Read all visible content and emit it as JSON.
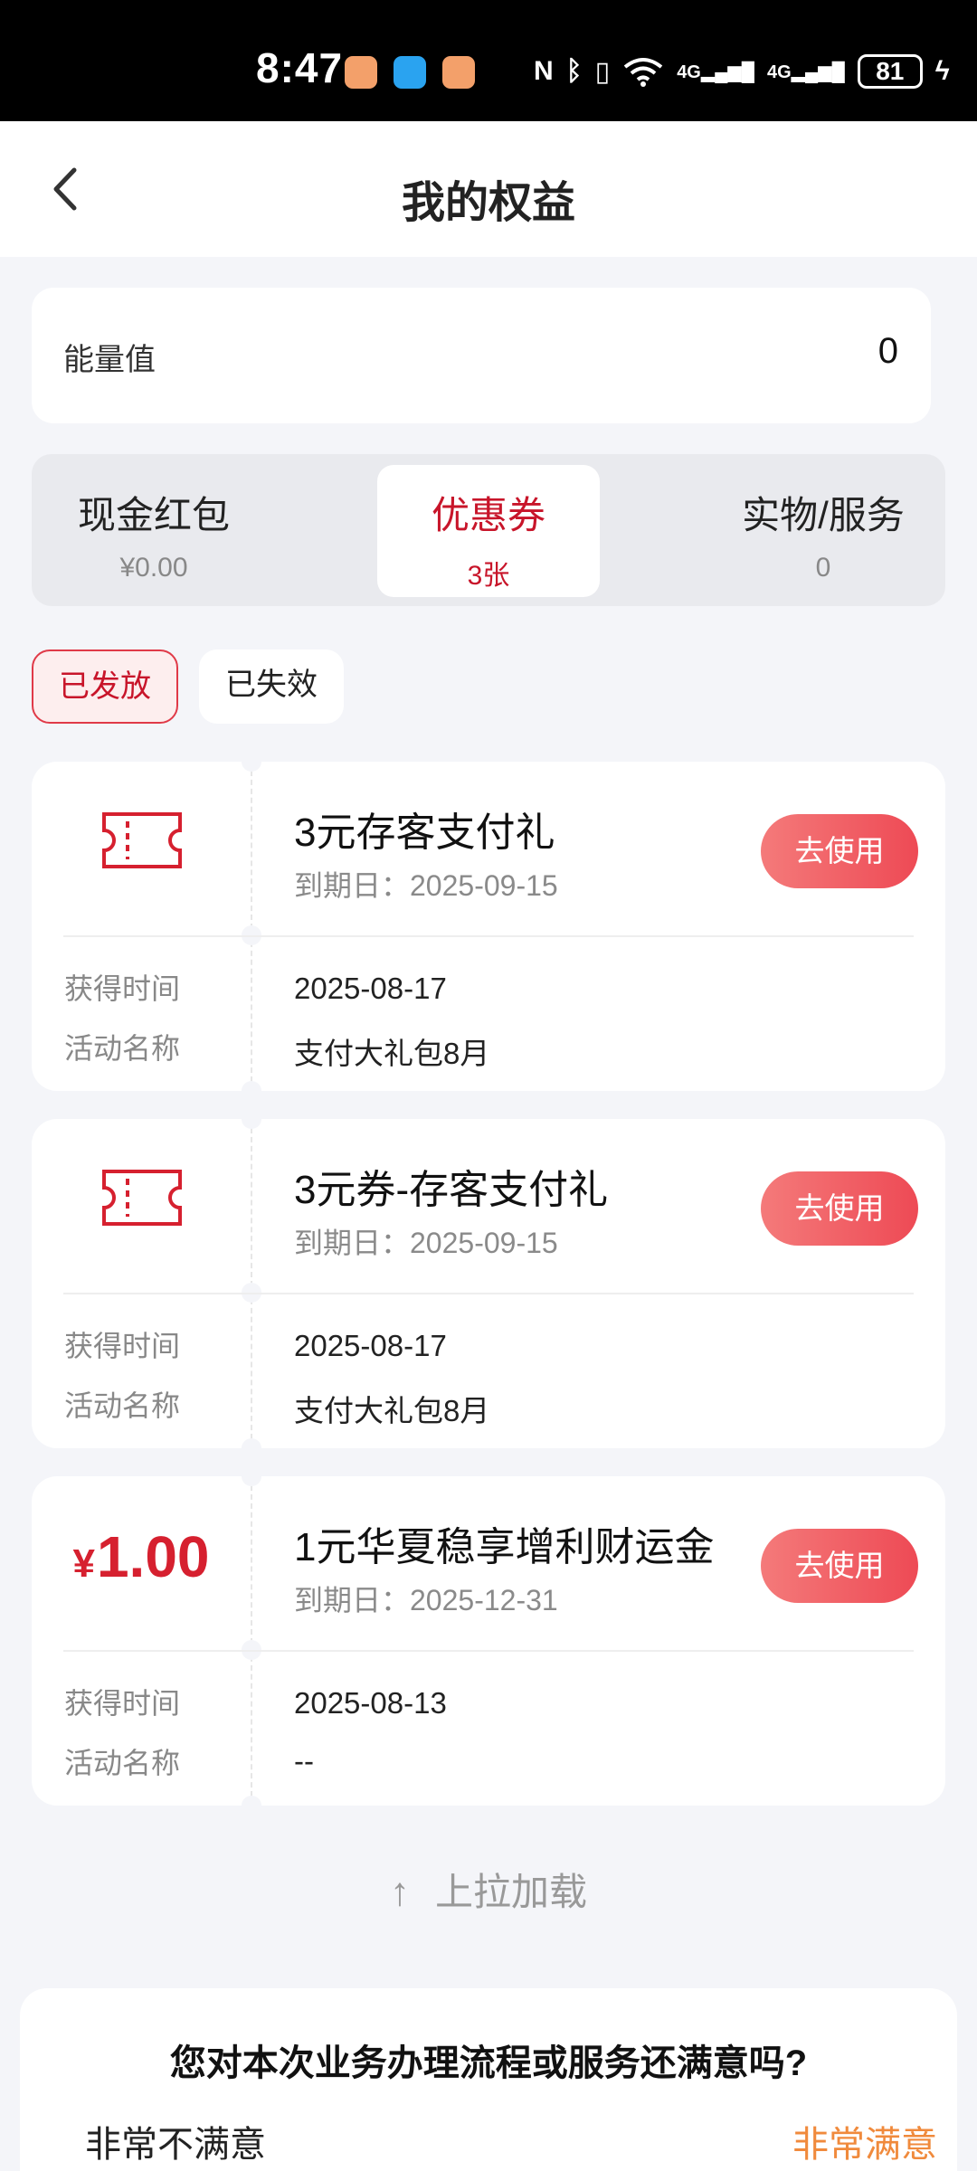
{
  "status_bar": {
    "time": "8:47",
    "battery": "81",
    "network_1": "4G",
    "network_2": "4G"
  },
  "header": {
    "title": "我的权益"
  },
  "energy": {
    "label": "能量值",
    "value": "0"
  },
  "tabs": [
    {
      "title": "现金红包",
      "sub": "¥0.00"
    },
    {
      "title": "优惠券",
      "sub": "3张"
    },
    {
      "title": "实物/服务",
      "sub": "0"
    }
  ],
  "filters": [
    {
      "label": "已发放"
    },
    {
      "label": "已失效"
    }
  ],
  "coupons": [
    {
      "title": "3元存客支付礼",
      "expiry": "到期日：2025-09-15",
      "button": "去使用",
      "obtained_label": "获得时间",
      "obtained_value": "2025-08-17",
      "activity_label": "活动名称",
      "activity_value": "支付大礼包8月"
    },
    {
      "title": "3元券-存客支付礼",
      "expiry": "到期日：2025-09-15",
      "button": "去使用",
      "obtained_label": "获得时间",
      "obtained_value": "2025-08-17",
      "activity_label": "活动名称",
      "activity_value": "支付大礼包8月"
    },
    {
      "amount_symbol": "¥",
      "amount": "1.00",
      "title": "1元华夏稳享增利财运金",
      "expiry": "到期日：2025-12-31",
      "button": "去使用",
      "obtained_label": "获得时间",
      "obtained_value": "2025-08-13",
      "activity_label": "活动名称",
      "activity_value": "--"
    }
  ],
  "load_more": {
    "label": "上拉加载"
  },
  "survey": {
    "question": "您对本次业务办理流程或服务还满意吗?",
    "left": "非常不满意",
    "right": "非常满意"
  },
  "colors": {
    "accent": "#c8152a",
    "button": "#ee4a55",
    "satisfied": "#f08a3c"
  }
}
